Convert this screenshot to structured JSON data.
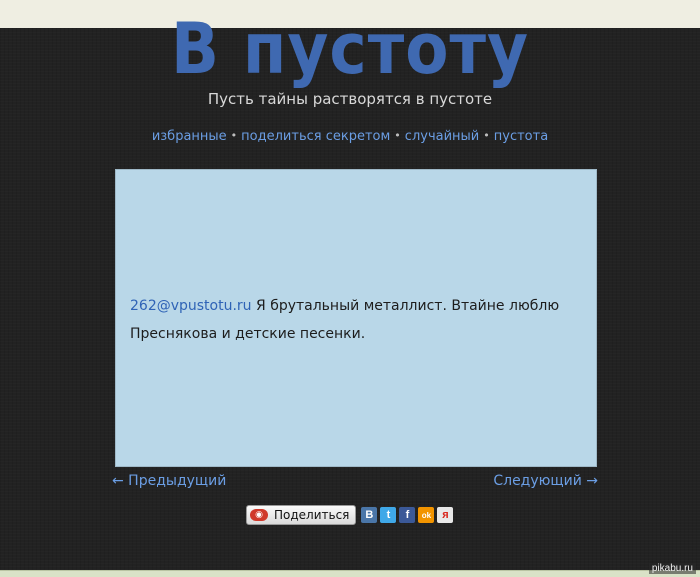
{
  "header": {
    "title": "В пустоту",
    "subtitle": "Пусть тайны растворятся в пустоте"
  },
  "nav": {
    "items": [
      {
        "label": "избранные"
      },
      {
        "label": "поделиться секретом"
      },
      {
        "label": "случайный"
      },
      {
        "label": "пустота"
      }
    ],
    "separator": "•"
  },
  "secret": {
    "author": "262@vpustotu.ru",
    "text": "Я брутальный металлист. Втайне люблю Преснякова и детские песенки."
  },
  "pager": {
    "prev": "← Предыдущий",
    "next": "Следующий →"
  },
  "share": {
    "label": "Поделиться",
    "networks": [
      {
        "name": "vk-icon",
        "glyph": "В",
        "color": "#4a76a8"
      },
      {
        "name": "twitter-icon",
        "glyph": "t",
        "color": "#3fa8e8"
      },
      {
        "name": "facebook-icon",
        "glyph": "f",
        "color": "#3b5998"
      },
      {
        "name": "odnoklassniki-icon",
        "glyph": "ok",
        "color": "#f29400"
      },
      {
        "name": "yandex-icon",
        "glyph": "я",
        "color": "#e8e8e8"
      }
    ]
  },
  "watermark": "pikabu.ru"
}
